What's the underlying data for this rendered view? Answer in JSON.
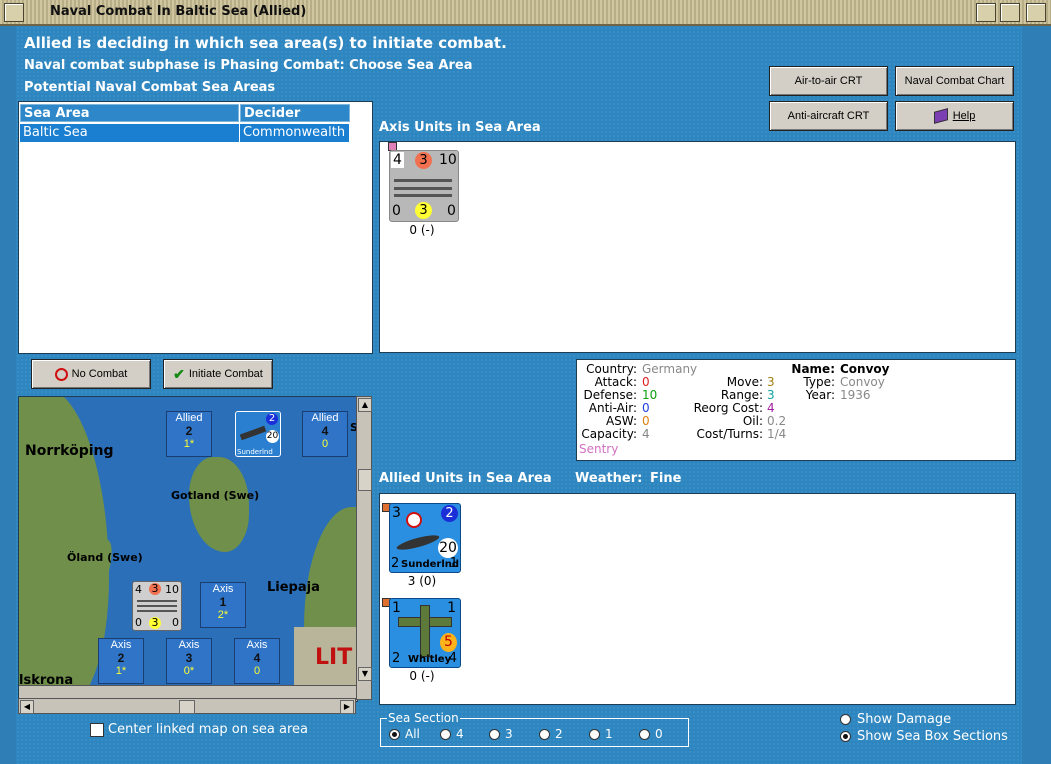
{
  "window": {
    "title": "Naval Combat In Baltic Sea (Allied)"
  },
  "header": {
    "line1": "Allied is deciding in which sea area(s) to initiate combat.",
    "line2": "Naval combat subphase is Phasing Combat: Choose Sea Area",
    "line3": "Potential Naval Combat Sea Areas"
  },
  "buttons": {
    "air_to_air": "Air-to-air CRT",
    "naval_chart": "Naval Combat Chart",
    "anti_aircraft": "Anti-aircraft CRT",
    "help": "Help",
    "no_combat": "No Combat",
    "initiate_combat": "Initiate Combat"
  },
  "sea_table": {
    "headers": [
      "Sea Area",
      "Decider"
    ],
    "rows": [
      [
        "Baltic Sea",
        "Commonwealth"
      ]
    ]
  },
  "axis_panel": {
    "title": "Axis Units in Sea Area",
    "unit": {
      "top_left": "4",
      "top_mid": "3",
      "top_right": "10",
      "bot_left": "0",
      "bot_mid": "3",
      "bot_right": "0",
      "caption": "0 (-)"
    }
  },
  "info": {
    "country_label": "Country:",
    "country": "Germany",
    "attack_label": "Attack:",
    "attack": "0",
    "defense_label": "Defense:",
    "defense": "10",
    "antiair_label": "Anti-Air:",
    "antiair": "0",
    "asw_label": "ASW:",
    "asw": "0",
    "capacity_label": "Capacity:",
    "capacity": "4",
    "status": "Sentry",
    "move_label": "Move:",
    "move": "3",
    "range_label": "Range:",
    "range": "3",
    "reorg_label": "Reorg Cost:",
    "reorg": "4",
    "oil_label": "Oil:",
    "oil": "0.2",
    "cost_label": "Cost/Turns:",
    "cost": "1/4",
    "name_label": "Name:",
    "name": "Convoy",
    "type_label": "Type:",
    "type": "Convoy",
    "year_label": "Year:",
    "year": "1936"
  },
  "allied_panel": {
    "title": "Allied Units in Sea Area",
    "weather_label": "Weather:",
    "weather": "Fine",
    "units": [
      {
        "tl": "3",
        "tr": "2",
        "mid": "20",
        "bl": "2",
        "name": "Sunderlnd",
        "br": "1",
        "caption": "3 (0)"
      },
      {
        "tl": "1",
        "tr": "1",
        "mid": "5",
        "bl": "2",
        "name": "Whitley",
        "br": "4",
        "caption": "0 (-)"
      }
    ]
  },
  "map": {
    "labels": {
      "norrkoping": "Norrköping",
      "gotland": "Gotland (Swe)",
      "oland": "Öland (Swe)",
      "liepaja": "Liepaja",
      "iskrona": "lskrona",
      "lit": "LIT",
      "s": "S"
    },
    "boxes": [
      {
        "side": "Allied",
        "n": "2",
        "v": "1*"
      },
      {
        "side": "Allied",
        "n": "4",
        "v": "0"
      },
      {
        "side": "Axis",
        "n": "1",
        "v": "2*"
      },
      {
        "side": "Axis",
        "n": "2",
        "v": "1*"
      },
      {
        "side": "Axis",
        "n": "3",
        "v": "0*"
      },
      {
        "side": "Axis",
        "n": "4",
        "v": "0"
      }
    ],
    "map_unit": {
      "tl": "4",
      "tm": "3",
      "tr": "10",
      "bl": "0",
      "bm": "3",
      "br": "0"
    },
    "map_air": {
      "tr": "2",
      "mid": "20",
      "name": "Sunderlnd"
    }
  },
  "center_map_label": "Center linked map on sea area",
  "sea_section": {
    "title": "Sea Section",
    "options": [
      "All",
      "4",
      "3",
      "2",
      "1",
      "0"
    ],
    "selected": "All"
  },
  "display_options": {
    "show_damage": "Show Damage",
    "show_sections": "Show Sea Box Sections"
  },
  "colors": {
    "accent": "#2e86c0",
    "selection": "#1a7fd1"
  }
}
